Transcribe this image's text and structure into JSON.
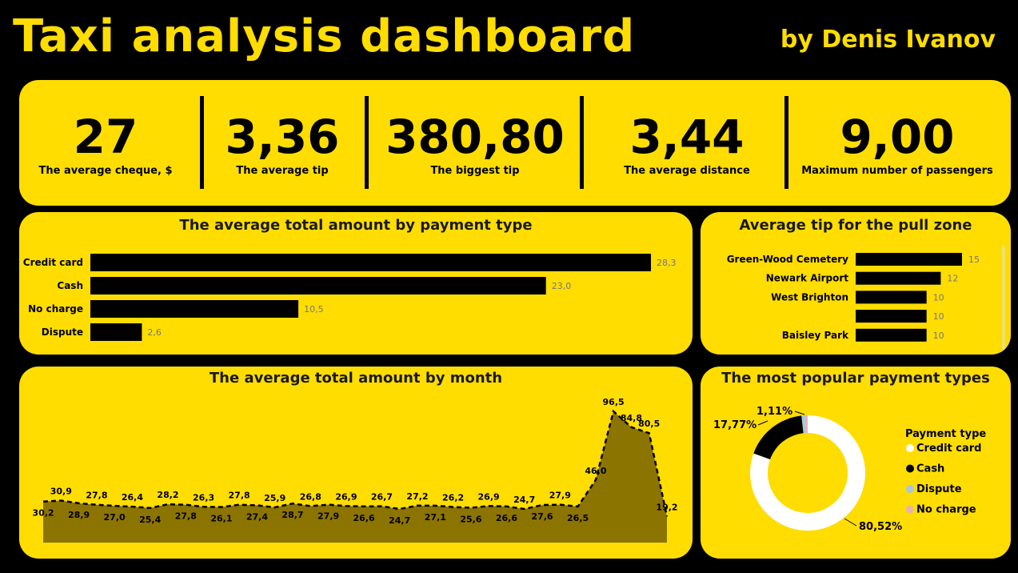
{
  "header": {
    "title": "Taxi analysis dashboard",
    "author": "by Denis Ivanov"
  },
  "kpis": [
    {
      "value": "27",
      "label": "The average cheque, $"
    },
    {
      "value": "3,36",
      "label": "The average tip"
    },
    {
      "value": "380,80",
      "label": "The biggest tip"
    },
    {
      "value": "3,44",
      "label": "The average distance"
    },
    {
      "value": "9,00",
      "label": "Maximum number of passengers"
    }
  ],
  "colors": {
    "accent": "#FFDD00",
    "background": "#000000",
    "area_fill": "#8C7400",
    "bar": "#000000"
  },
  "chart_data": [
    {
      "type": "bar",
      "orientation": "horizontal",
      "title": "The average total amount by payment type",
      "categories": [
        "Credit card",
        "Cash",
        "No charge",
        "Dispute"
      ],
      "values": [
        28.3,
        23.0,
        10.5,
        2.6
      ],
      "value_labels": [
        "28,3",
        "23,0",
        "10,5",
        "2,6"
      ]
    },
    {
      "type": "bar",
      "orientation": "horizontal",
      "title": "Average tip for the pull zone",
      "categories": [
        "Green-Wood Cemetery",
        "Newark Airport",
        "West Brighton",
        "",
        "Baisley Park"
      ],
      "values": [
        15,
        12,
        10,
        10,
        10
      ],
      "value_labels": [
        "15",
        "12",
        "10",
        "10",
        "10"
      ]
    },
    {
      "type": "area",
      "title": "The average total amount by month",
      "values": [
        30.2,
        30.9,
        28.9,
        27.8,
        27.0,
        26.4,
        25.4,
        28.2,
        27.8,
        26.3,
        26.1,
        27.8,
        27.4,
        25.9,
        28.7,
        26.8,
        27.9,
        26.9,
        26.6,
        26.7,
        24.7,
        27.2,
        27.1,
        26.2,
        25.6,
        26.9,
        26.6,
        24.7,
        27.6,
        27.9,
        26.5,
        46.0,
        96.5,
        84.8,
        80.5,
        19.2
      ],
      "value_labels": [
        "30,2",
        "30,9",
        "28,9",
        "27,8",
        "27,0",
        "26,4",
        "25,4",
        "28,2",
        "27,8",
        "26,3",
        "26,1",
        "27,8",
        "27,4",
        "25,9",
        "28,7",
        "26,8",
        "27,9",
        "26,9",
        "26,6",
        "26,7",
        "24,7",
        "27,2",
        "27,1",
        "26,2",
        "25,6",
        "26,9",
        "26,6",
        "24,7",
        "27,6",
        "27,9",
        "26,5",
        "46,0",
        "96,5",
        "84,8",
        "80,5",
        "19,2"
      ]
    },
    {
      "type": "pie",
      "style": "donut",
      "title": "The most popular payment types",
      "legend_title": "Payment type",
      "legend_placement": "right",
      "categories": [
        "Credit card",
        "Cash",
        "Dispute",
        "No charge"
      ],
      "values": [
        80.52,
        17.77,
        1.11,
        0.6
      ],
      "value_labels": [
        "80,52%",
        "17,77%",
        "1,11%",
        ""
      ],
      "colors": [
        "#FFFFFF",
        "#000000",
        "#A8C8E0",
        "#E8B4B0"
      ]
    }
  ]
}
